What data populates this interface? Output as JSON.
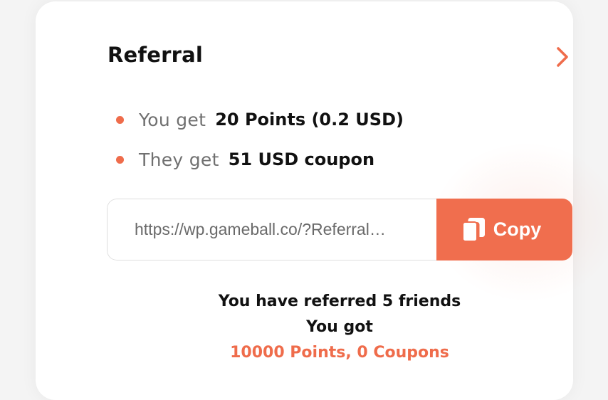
{
  "referral": {
    "title": "Referral",
    "details_icon": "chevron-right-icon",
    "benefits": [
      {
        "prefix": "You get",
        "value": "20 Points (0.2 USD)"
      },
      {
        "prefix": "They get",
        "value": "51 USD coupon"
      }
    ],
    "link": {
      "value": "https://wp.gameball.co/?Referral…"
    },
    "copy_button": {
      "label": "Copy",
      "icon": "copy-icon"
    },
    "summary": {
      "referred_text": "You have referred 5 friends",
      "got_text": "You got",
      "earned_text": "10000 Points, 0 Coupons"
    }
  },
  "colors": {
    "accent": "#ef6c4b",
    "button_bg": "#f06e4e",
    "text_primary": "#111111",
    "text_secondary": "#707070",
    "card_bg": "#ffffff",
    "page_bg": "#f4f4f4"
  }
}
